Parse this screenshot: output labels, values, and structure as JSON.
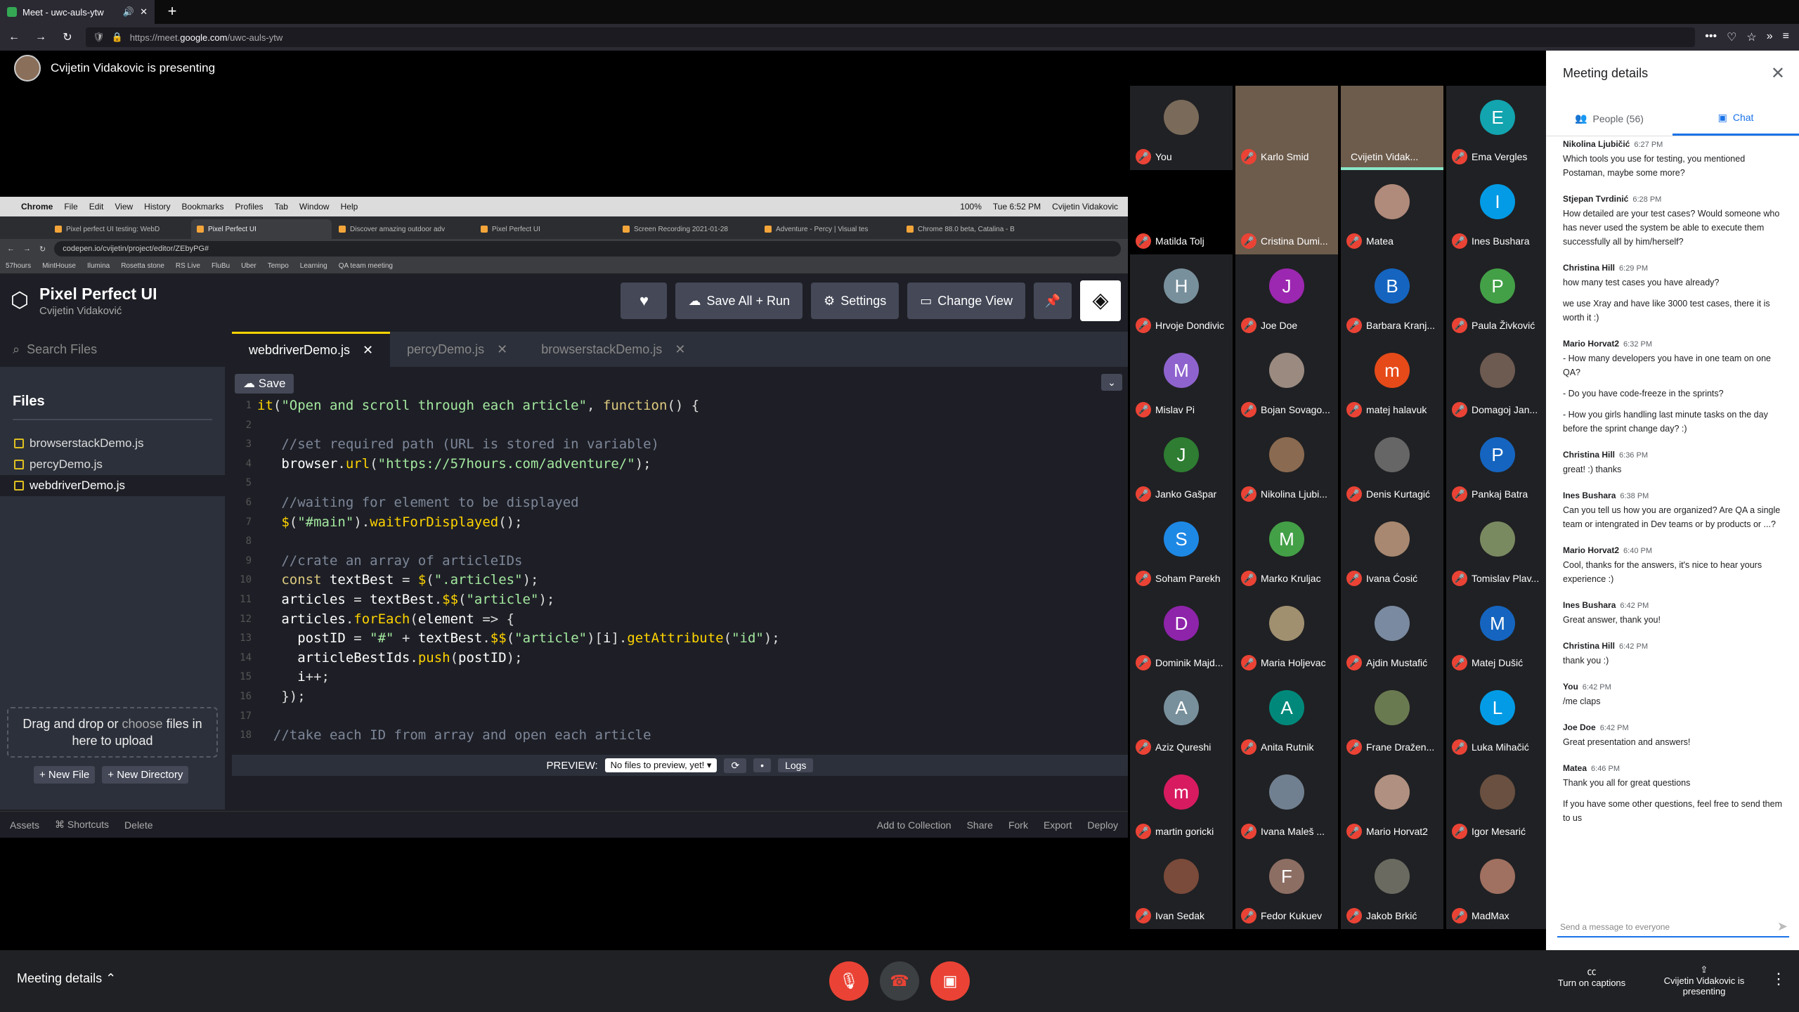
{
  "browser": {
    "tab_title": "Meet - uwc-auls-ytw",
    "url_prefix": "https://meet.",
    "url_domain": "google.com",
    "url_path": "/uwc-auls-ytw"
  },
  "presenter_banner": "Cvijetin Vidakovic is presenting",
  "mac_menu": [
    "Chrome",
    "File",
    "Edit",
    "View",
    "History",
    "Bookmarks",
    "Profiles",
    "Tab",
    "Window",
    "Help"
  ],
  "mac_status": {
    "battery": "100%",
    "clock": "Tue 6:52 PM",
    "user": "Cvijetin Vidakovic"
  },
  "chrome_tabs": [
    "Pixel perfect UI testing: WebD",
    "Pixel Perfect UI",
    "Discover amazing outdoor adv",
    "Pixel Perfect UI",
    "Screen Recording 2021-01-28",
    "Adventure - Percy | Visual tes",
    "Chrome 88.0 beta, Catalina - B"
  ],
  "chrome_url": "codepen.io/cvijetin/project/editor/ZEbyPG#",
  "bookmarks": [
    "57hours",
    "MintHouse",
    "Ilumina",
    "Rosetta stone",
    "RS Live",
    "FluBu",
    "Uber",
    "Tempo",
    "Learning",
    "QA team meeting"
  ],
  "codepen": {
    "title": "Pixel Perfect UI",
    "user": "Cvijetin Vidaković",
    "buttons": {
      "save_run": "Save All + Run",
      "settings": "Settings",
      "change_view": "Change View"
    },
    "search_placeholder": "Search Files",
    "files_heading": "Files",
    "files": [
      "browserstackDemo.js",
      "percyDemo.js",
      "webdriverDemo.js"
    ],
    "drop_text": "Drag and drop or",
    "drop_choose": "choose",
    "drop_text2": "files in here to upload",
    "new_file": "+ New File",
    "new_dir": "+ New Directory",
    "tabs": [
      "webdriverDemo.js",
      "percyDemo.js",
      "browserstackDemo.js"
    ],
    "save": "Save",
    "preview_label": "PREVIEW:",
    "preview_select": "No files to preview, yet!",
    "logs": "Logs",
    "footer_left": [
      "Assets",
      "⌘ Shortcuts",
      "Delete"
    ],
    "footer_right": [
      "Add to Collection",
      "Share",
      "Fork",
      "Export",
      "Deploy"
    ]
  },
  "code_lines": [
    {
      "n": "1",
      "html": "<span class='f'>it</span>(<span class='s'>\"Open and scroll through each article\"</span>, <span class='k'>function</span>() {"
    },
    {
      "n": "2",
      "html": ""
    },
    {
      "n": "3",
      "html": "   <span class='cm'>//set required path (URL is stored in variable)</span>"
    },
    {
      "n": "4",
      "html": "   <span class='v'>browser</span>.<span class='f'>url</span>(<span class='s'>\"https://57hours.com/adventure/\"</span>);"
    },
    {
      "n": "5",
      "html": ""
    },
    {
      "n": "6",
      "html": "   <span class='cm'>//waiting for element to be displayed</span>"
    },
    {
      "n": "7",
      "html": "   <span class='f'>$</span>(<span class='s'>\"#main\"</span>).<span class='f'>waitForDisplayed</span>();"
    },
    {
      "n": "8",
      "html": ""
    },
    {
      "n": "9",
      "html": "   <span class='cm'>//crate an array of articleIDs</span>"
    },
    {
      "n": "10",
      "html": "   <span class='k'>const</span> <span class='v'>textBest</span> = <span class='f'>$</span>(<span class='s'>\".articles\"</span>);"
    },
    {
      "n": "11",
      "html": "   <span class='v'>articles</span> = <span class='v'>textBest</span>.<span class='f'>$$</span>(<span class='s'>\"article\"</span>);"
    },
    {
      "n": "12",
      "html": "   <span class='v'>articles</span>.<span class='f'>forEach</span>(<span class='v'>element</span> => {"
    },
    {
      "n": "13",
      "html": "     <span class='v'>postID</span> = <span class='s'>\"#\"</span> + <span class='v'>textBest</span>.<span class='f'>$$</span>(<span class='s'>\"article\"</span>)[<span class='v'>i</span>].<span class='f'>getAttribute</span>(<span class='s'>\"id\"</span>);"
    },
    {
      "n": "14",
      "html": "     <span class='v'>articleBestIds</span>.<span class='f'>push</span>(<span class='v'>postID</span>);"
    },
    {
      "n": "15",
      "html": "     <span class='v'>i</span>++;"
    },
    {
      "n": "16",
      "html": "   });"
    },
    {
      "n": "17",
      "html": ""
    },
    {
      "n": "18",
      "html": "  <span class='cm'>//take each ID from array and open each article</span>"
    }
  ],
  "participants": [
    {
      "name": "You",
      "av": "ph",
      "color": "#7a6a5a"
    },
    {
      "name": "Karlo Smid",
      "av": "vid",
      "color": "#8a7060"
    },
    {
      "name": "Cvijetin Vidak...",
      "av": "vid",
      "color": "#6a6058"
    },
    {
      "name": "Ema Vergles",
      "av": "E",
      "color": "#12a4af"
    },
    {
      "name": "Matilda Tolj",
      "av": "blank",
      "color": "#000"
    },
    {
      "name": "Cristina Dumi...",
      "av": "vid",
      "color": "#5c5550"
    },
    {
      "name": "Matea",
      "av": "ph",
      "color": "#b08a7a"
    },
    {
      "name": "Ines Bushara",
      "av": "I",
      "color": "#039be5"
    },
    {
      "name": "Hrvoje Dondivic",
      "av": "H",
      "color": "#78909c"
    },
    {
      "name": "Joe Doe",
      "av": "J",
      "color": "#9c27b0"
    },
    {
      "name": "Barbara Kranj...",
      "av": "B",
      "color": "#1565c0"
    },
    {
      "name": "Paula Živković",
      "av": "P",
      "color": "#43a047"
    },
    {
      "name": "Mislav Pi",
      "av": "M",
      "color": "#8e63ce"
    },
    {
      "name": "Bojan Sovago...",
      "av": "ph",
      "color": "#9a8a80"
    },
    {
      "name": "matej halavuk",
      "av": "m",
      "color": "#e64a19"
    },
    {
      "name": "Domagoj Jan...",
      "av": "ph",
      "color": "#6d5a50"
    },
    {
      "name": "Janko Gašpar",
      "av": "J",
      "color": "#2e7d32"
    },
    {
      "name": "Nikolina Ljubi...",
      "av": "ph",
      "color": "#8a6a50"
    },
    {
      "name": "Denis Kurtagić",
      "av": "ph",
      "color": "#666"
    },
    {
      "name": "Pankaj Batra",
      "av": "P",
      "color": "#1565c0"
    },
    {
      "name": "Soham Parekh",
      "av": "S",
      "color": "#1e88e5"
    },
    {
      "name": "Marko Kruljac",
      "av": "M",
      "color": "#43a047"
    },
    {
      "name": "Ivana Ćosić",
      "av": "ph",
      "color": "#a88870"
    },
    {
      "name": "Tomislav Plav...",
      "av": "ph",
      "color": "#7a8a60"
    },
    {
      "name": "Dominik Majd...",
      "av": "D",
      "color": "#8e24aa"
    },
    {
      "name": "Maria Holjevac",
      "av": "ph",
      "color": "#a09070"
    },
    {
      "name": "Ajdin Mustafić",
      "av": "ph",
      "color": "#7a8aa0"
    },
    {
      "name": "Matej Dušić",
      "av": "M",
      "color": "#1565c0"
    },
    {
      "name": "Aziz Qureshi",
      "av": "A",
      "color": "#78909c"
    },
    {
      "name": "Anita Rutnik",
      "av": "A",
      "color": "#00897b"
    },
    {
      "name": "Frane Dražen...",
      "av": "ph",
      "color": "#6a7a50"
    },
    {
      "name": "Luka Mihačić",
      "av": "L",
      "color": "#039be5"
    },
    {
      "name": "martin goricki",
      "av": "m",
      "color": "#d81b60"
    },
    {
      "name": "Ivana Maleš ...",
      "av": "ph",
      "color": "#708090"
    },
    {
      "name": "Mario Horvat2",
      "av": "ph",
      "color": "#b09080"
    },
    {
      "name": "Igor Mesarić",
      "av": "ph",
      "color": "#6a5040"
    },
    {
      "name": "Ivan Sedak",
      "av": "ph",
      "color": "#7a4a3a"
    },
    {
      "name": "Fedor Kukuev",
      "av": "F",
      "color": "#8d6e63"
    },
    {
      "name": "Jakob Brkić",
      "av": "ph",
      "color": "#6a6a60"
    },
    {
      "name": "MadMax",
      "av": "ph",
      "color": "#a07060"
    }
  ],
  "panel": {
    "title": "Meeting details",
    "people_tab": "People (56)",
    "chat_tab": "Chat",
    "input_placeholder": "Send a message to everyone",
    "messages": [
      {
        "author": "Nikolina Ljubičić",
        "time": "6:27 PM",
        "text": [
          "Which tools you use for testing, you mentioned Postaman, maybe some more?"
        ]
      },
      {
        "author": "Stjepan Tvrdinić",
        "time": "6:28 PM",
        "text": [
          "How detailed are your test cases? Would someone who has never used the system be able to execute them successfully all by him/herself?"
        ]
      },
      {
        "author": "Christina Hill",
        "time": "6:29 PM",
        "text": [
          "how many test cases you have already?",
          "we use Xray and have like 3000 test cases, there it is worth it :)"
        ]
      },
      {
        "author": "Mario Horvat2",
        "time": "6:32 PM",
        "text": [
          "- How many developers you have in one team on one QA?",
          "- Do you have code-freeze in the sprints?",
          "- How you girls handling last minute tasks on the day before the sprint change day? :)"
        ]
      },
      {
        "author": "Christina Hill",
        "time": "6:36 PM",
        "text": [
          "great! :) thanks"
        ]
      },
      {
        "author": "Ines Bushara",
        "time": "6:38 PM",
        "text": [
          "Can you tell us how you are organized? Are QA a single team or intengrated in Dev teams or by products or ...?"
        ]
      },
      {
        "author": "Mario Horvat2",
        "time": "6:40 PM",
        "text": [
          "Cool, thanks for the answers, it's nice to hear yours experience :)"
        ]
      },
      {
        "author": "Ines Bushara",
        "time": "6:42 PM",
        "text": [
          "Great answer, thank you!"
        ]
      },
      {
        "author": "Christina Hill",
        "time": "6:42 PM",
        "text": [
          "thank you :)"
        ]
      },
      {
        "author": "You",
        "time": "6:42 PM",
        "text": [
          "/me claps"
        ]
      },
      {
        "author": "Joe Doe",
        "time": "6:42 PM",
        "text": [
          "Great presentation and answers!"
        ]
      },
      {
        "author": "Matea",
        "time": "6:46 PM",
        "text": [
          "Thank you all for great questions",
          "If you have some other questions, feel free to send them to us"
        ]
      }
    ]
  },
  "bottom": {
    "meeting_details": "Meeting details",
    "captions": "Turn on captions",
    "presenting": "Cvijetin Vidakovic is presenting"
  }
}
